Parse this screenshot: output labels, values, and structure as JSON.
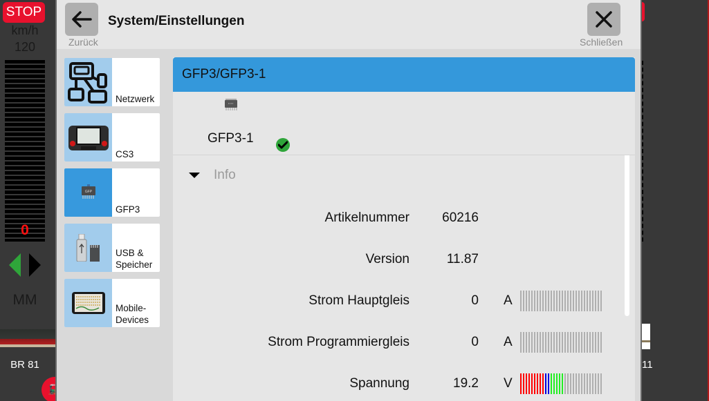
{
  "loco_left": {
    "stop_label": "STOP",
    "speed_unit": "km/h",
    "speed_max": "120",
    "speed_value": "0",
    "speed_fraction": 0,
    "direction": "forward-left",
    "protocol": "MM",
    "name": "BR 81",
    "badge_icon": "train-icon"
  },
  "loco_right": {
    "name_partial": "11"
  },
  "modal": {
    "title": "System/Einstellungen",
    "back_label": "Zurück",
    "close_label": "Schließen"
  },
  "sidebar": {
    "items": [
      {
        "label": "Netzwerk",
        "icon": "network-icon",
        "active": false
      },
      {
        "label": "CS3",
        "icon": "cs3-device-icon",
        "active": false
      },
      {
        "label": "GFP3",
        "icon": "chip-icon",
        "active": true
      },
      {
        "label": "USB &\nSpeicher",
        "label_line1": "USB &",
        "label_line2": "Speicher",
        "icon": "usb-storage-icon",
        "active": false
      },
      {
        "label": "Mobile-\nDevices",
        "label_line1": "Mobile-",
        "label_line2": "Devices",
        "icon": "tablet-icon",
        "active": false
      }
    ]
  },
  "panel": {
    "header": "GFP3/GFP3-1",
    "device_name": "GFP3-1",
    "device_status": "ok",
    "section_label": "Info",
    "rows": [
      {
        "label": "Artikelnummer",
        "value": "60216"
      },
      {
        "label": "Version",
        "value": "11.87"
      },
      {
        "label": "Strom Hauptgleis",
        "value": "0",
        "unit": "A",
        "meter": {
          "segments": 30,
          "red": 0,
          "blue": 0,
          "green": 0
        }
      },
      {
        "label": "Strom Programmiergleis",
        "value": "0",
        "unit": "A",
        "meter": {
          "segments": 30,
          "red": 0,
          "blue": 0,
          "green": 0
        }
      },
      {
        "label": "Spannung",
        "value": "19.2",
        "unit": "V",
        "meter": {
          "segments": 30,
          "red": 9,
          "blue": 2,
          "green": 5
        }
      }
    ]
  },
  "colors": {
    "accent": "#3498db",
    "tile_icon_bg": "#a2ccec",
    "stop": "#e8112d",
    "ok": "#2fa53a",
    "meter_off": "#afafaf",
    "meter_red": "#ff0000",
    "meter_blue": "#0000dd",
    "meter_green": "#22ee22"
  }
}
